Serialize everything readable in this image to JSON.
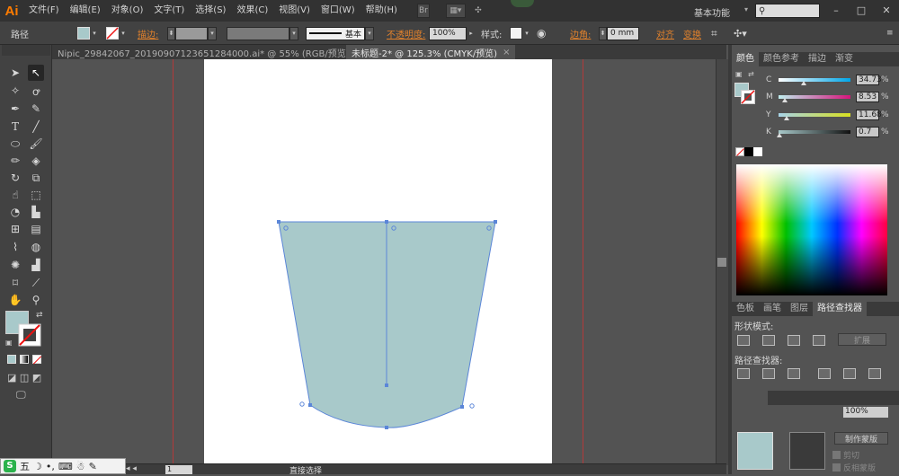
{
  "app": {
    "logo": "Ai",
    "menu": [
      "文件(F)",
      "编辑(E)",
      "对象(O)",
      "文字(T)",
      "选择(S)",
      "效果(C)",
      "视图(V)",
      "窗口(W)",
      "帮助(H)"
    ],
    "workspace": "基本功能",
    "search_placeholder": ""
  },
  "controlbar": {
    "selection_label": "路径",
    "stroke_label": "描边:",
    "stroke_style": "基本",
    "opacity_label": "不透明度:",
    "opacity_value": "100%",
    "style_label": "样式:",
    "corner_label": "边角:",
    "corner_value": "0 mm",
    "align_label": "对齐",
    "transform_label": "变换",
    "fill_color": "#a8c9ca"
  },
  "tabs": [
    {
      "label": "Nipic_29842067_20190907123651284000.ai* @ 55% (RGB/预览)",
      "active": false
    },
    {
      "label": "未标题-2* @ 125.3% (CMYK/预览)",
      "active": true
    }
  ],
  "toolbar": {
    "tools": [
      "selection-icon",
      "direct-selection-icon",
      "magic-wand-icon",
      "lasso-icon",
      "pen-icon",
      "curvature-icon",
      "type-icon",
      "line-icon",
      "ellipse-icon",
      "paintbrush-icon",
      "pencil-icon",
      "eraser-icon",
      "rotate-icon",
      "scale-icon",
      "warp-icon",
      "free-transform-icon",
      "shape-builder-icon",
      "perspective-icon",
      "mesh-icon",
      "gradient-icon",
      "eyedropper-icon",
      "blend-icon",
      "symbol-sprayer-icon",
      "column-graph-icon",
      "artboard-icon",
      "slice-icon",
      "hand-icon",
      "zoom-icon"
    ],
    "fill_color": "#a8c9ca"
  },
  "canvas": {
    "shape_fill": "#a8c9ca",
    "shape_stroke": "#5b86d8"
  },
  "statusbar": {
    "zoom": "125.3%",
    "artboard_num": "1",
    "tool_name": "直接选择"
  },
  "color_panel": {
    "tabs": [
      "颜色",
      "颜色参考",
      "描边",
      "渐变"
    ],
    "channels": [
      {
        "label": "C",
        "value": "34.73",
        "fraction": 0.35
      },
      {
        "label": "M",
        "value": "8.53",
        "fraction": 0.085
      },
      {
        "label": "Y",
        "value": "11.68",
        "fraction": 0.117
      },
      {
        "label": "K",
        "value": "0.7",
        "fraction": 0.007
      }
    ],
    "unit": "%"
  },
  "pathfinder_panel": {
    "tabs": [
      "色板",
      "画笔",
      "图层",
      "路径查找器"
    ],
    "shape_modes_label": "形状模式:",
    "expand_label": "扩展",
    "pathfinders_label": "路径查找器:"
  },
  "transparency_panel": {
    "opacity_value": "100%",
    "make_mask_label": "制作蒙版",
    "clip_label": "剪切",
    "invert_label": "反相蒙版"
  },
  "ime": {
    "text": "五"
  }
}
